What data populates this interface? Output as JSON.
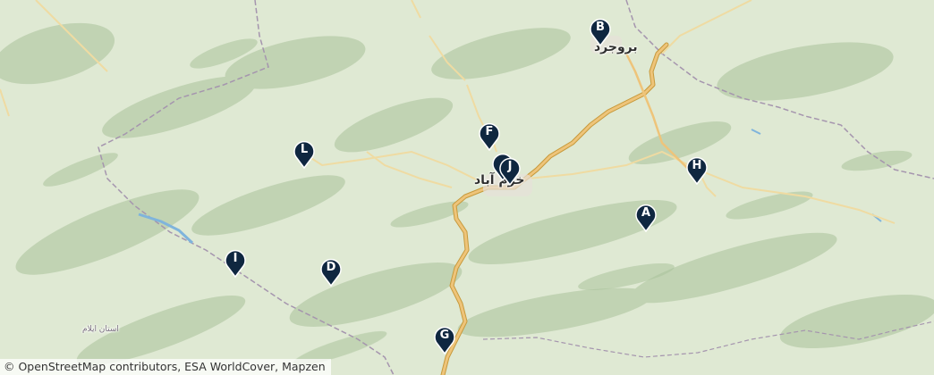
{
  "map": {
    "colors": {
      "land": "#dfe9d3",
      "forest": "#b9cfab",
      "road": "#e9c06b",
      "road_casing": "#c79a3c",
      "secondary_road": "#f0dca6",
      "border": "#9c8fa6",
      "water": "#7fb4dc",
      "marker": "#0f2740"
    },
    "markers": [
      {
        "id": "A",
        "label": "A"
      },
      {
        "id": "B",
        "label": "B"
      },
      {
        "id": "D",
        "label": "D"
      },
      {
        "id": "F",
        "label": "F"
      },
      {
        "id": "G",
        "label": "G"
      },
      {
        "id": "H",
        "label": "H"
      },
      {
        "id": "I",
        "label": "I"
      },
      {
        "id": "J",
        "label": "J"
      },
      {
        "id": "L",
        "label": "L"
      }
    ],
    "places": {
      "borujerd": "بروجرد",
      "khorramabad": "خرم آباد",
      "ilam_province": "استان ایلام"
    },
    "attribution": "© OpenStreetMap contributors, ESA WorldCover, Mapzen"
  }
}
